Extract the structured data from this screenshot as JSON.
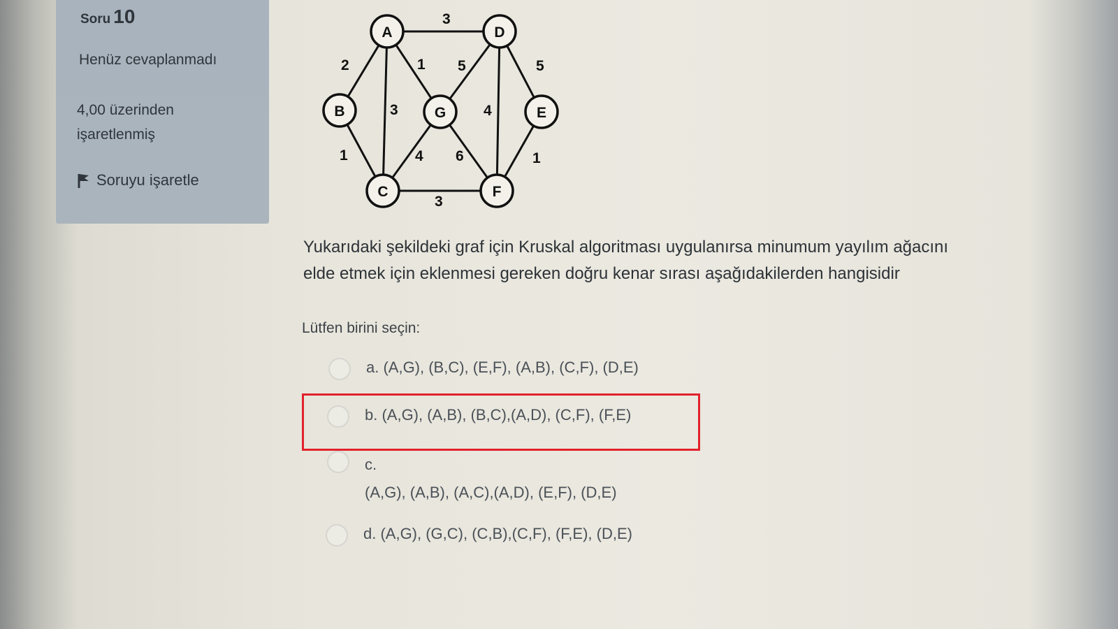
{
  "sidebar": {
    "question_label": "Soru",
    "question_number": "10",
    "status": "Henüz cevaplanmadı",
    "grade_line1": "4,00 üzerinden",
    "grade_line2": "işaretlenmiş",
    "flag_label": "Soruyu işaretle",
    "flag_icon": "flag-icon"
  },
  "graph": {
    "nodes": [
      "A",
      "B",
      "C",
      "D",
      "E",
      "F",
      "G"
    ],
    "edges": [
      {
        "from": "A",
        "to": "D",
        "weight": "3"
      },
      {
        "from": "A",
        "to": "B",
        "weight": "2"
      },
      {
        "from": "A",
        "to": "G",
        "weight": "1"
      },
      {
        "from": "A",
        "to": "C",
        "weight": "3"
      },
      {
        "from": "D",
        "to": "G",
        "weight": "5"
      },
      {
        "from": "D",
        "to": "E",
        "weight": "5"
      },
      {
        "from": "D",
        "to": "F",
        "weight": "4"
      },
      {
        "from": "B",
        "to": "C",
        "weight": "1"
      },
      {
        "from": "G",
        "to": "C",
        "weight": "4"
      },
      {
        "from": "G",
        "to": "F",
        "weight": "6"
      },
      {
        "from": "E",
        "to": "F",
        "weight": "1"
      },
      {
        "from": "C",
        "to": "F",
        "weight": "3"
      }
    ]
  },
  "question": {
    "line1": "Yukarıdaki şekildeki graf için Kruskal algoritması uygulanırsa minumum yayılım ağacını",
    "line2": "elde etmek için eklenmesi gereken doğru kenar sırası aşağıdakilerden hangisidir",
    "prompt": "Lütfen birini seçin:"
  },
  "options": [
    {
      "text": "a. (A,G), (B,C), (E,F), (A,B), (C,F), (D,E)"
    },
    {
      "text": "b. (A,G), (A,B), (B,C),(A,D), (C,F), (F,E)"
    },
    {
      "letter": "c.",
      "text": "(A,G), (A,B), (A,C),(A,D), (E,F), (D,E)"
    },
    {
      "text": "d. (A,G), (G,C), (C,B),(C,F), (F,E), (D,E)"
    }
  ],
  "colors": {
    "highlight": "#e2222c",
    "panel": "#aab4bd"
  }
}
